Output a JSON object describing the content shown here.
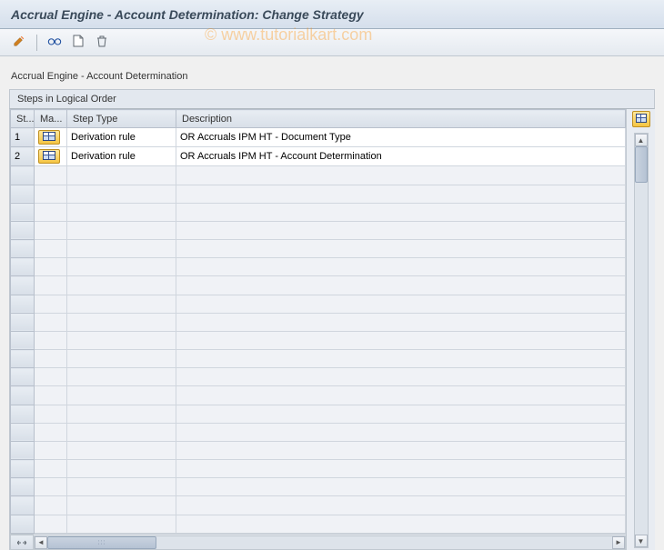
{
  "window": {
    "title": "Accrual Engine - Account Determination: Change Strategy"
  },
  "watermark": "© www.tutorialkart.com",
  "toolbar": {
    "change": "Change",
    "display": "Display",
    "create": "Create",
    "delete": "Delete"
  },
  "subtitle": "Accrual Engine - Account Determination",
  "group": {
    "title": "Steps in Logical Order"
  },
  "columns": {
    "step": "St...",
    "maint": "Ma...",
    "step_type": "Step Type",
    "description": "Description"
  },
  "rows": [
    {
      "step": "1",
      "step_type": "Derivation rule",
      "description": "OR Accruals IPM HT - Document Type"
    },
    {
      "step": "2",
      "step_type": "Derivation rule",
      "description": "OR Accruals IPM HT - Account Determination"
    }
  ],
  "icons": {
    "pencil": "pencil-icon",
    "glasses": "glasses-icon",
    "page": "page-icon",
    "trash": "trash-icon",
    "grid": "grid-icon",
    "config": "table-settings-icon"
  }
}
